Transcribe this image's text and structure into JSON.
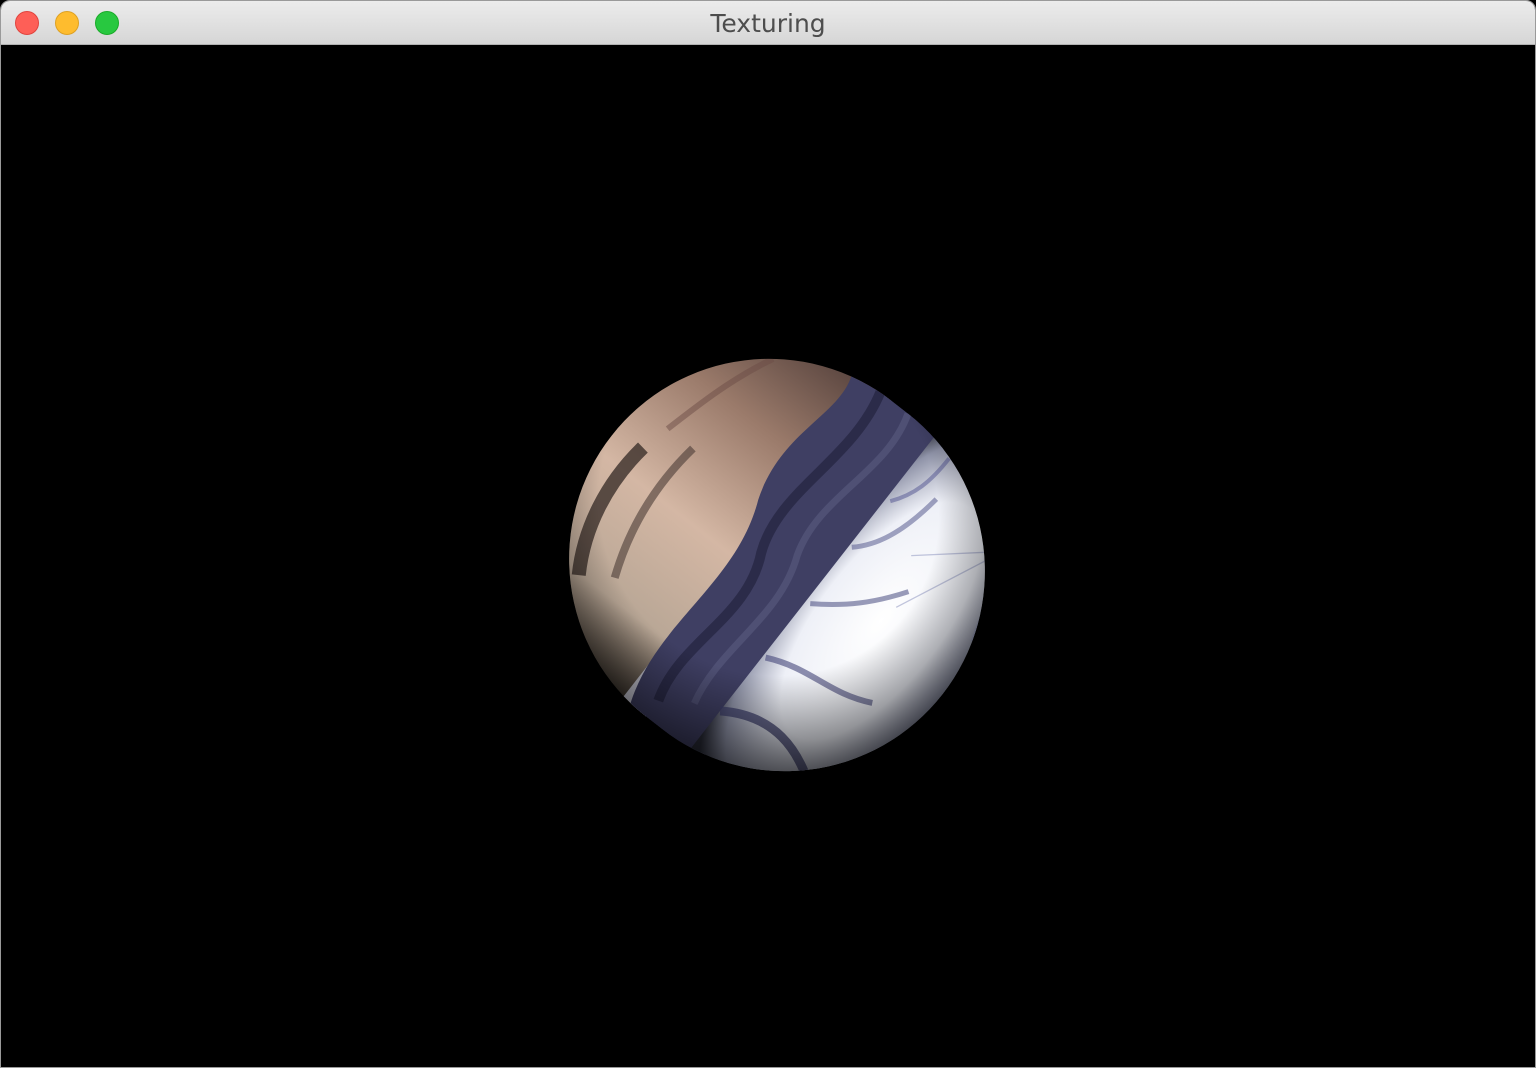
{
  "window": {
    "title": "Texturing"
  },
  "traffic_lights": {
    "close": "#fe5f57",
    "minimize": "#febc2e",
    "zoom": "#28c840"
  },
  "viewport": {
    "background": "#000000",
    "object": "textured-capsule"
  }
}
